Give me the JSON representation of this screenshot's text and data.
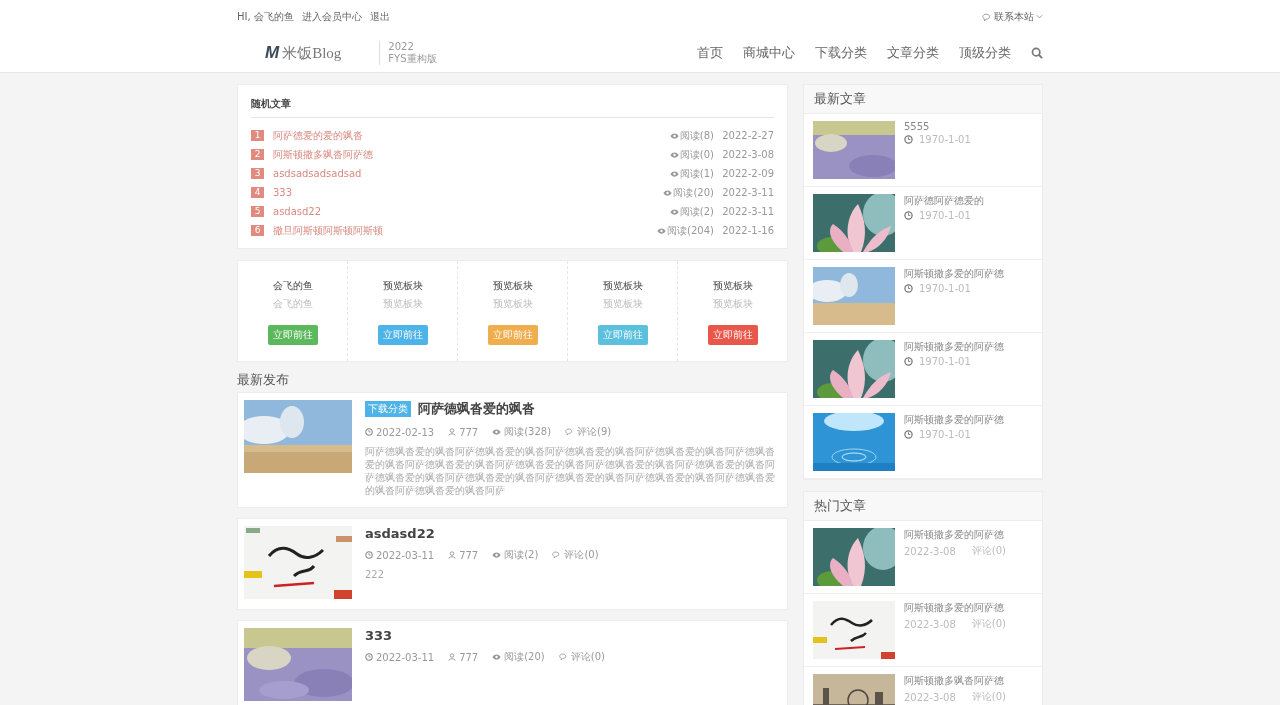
{
  "topbar": {
    "greeting": "HI, 会飞的鱼",
    "links": [
      "进入会员中心",
      "退出"
    ],
    "contact": "联系本站"
  },
  "header": {
    "logo_mark": "M",
    "logo_text": "米饭Blog",
    "version_year": "2022",
    "version_name": "FYS重构版"
  },
  "nav": [
    "首页",
    "商城中心",
    "下载分类",
    "文章分类",
    "顶级分类"
  ],
  "random_articles": {
    "title": "随机文章",
    "items": [
      {
        "rank": "1",
        "title": "阿萨德爱的爱的飒沓",
        "reads": "阅读(8)",
        "date": "2022-2-27"
      },
      {
        "rank": "2",
        "title": "阿斯顿撒多飒沓阿萨德",
        "reads": "阅读(0)",
        "date": "2022-3-08"
      },
      {
        "rank": "3",
        "title": "asdsadsadsadsad",
        "reads": "阅读(1)",
        "date": "2022-2-09"
      },
      {
        "rank": "4",
        "title": "333",
        "reads": "阅读(20)",
        "date": "2022-3-11"
      },
      {
        "rank": "5",
        "title": "asdasd22",
        "reads": "阅读(2)",
        "date": "2022-3-11"
      },
      {
        "rank": "6",
        "title": "撒旦阿斯顿阿斯顿阿斯顿",
        "reads": "阅读(204)",
        "date": "2022-1-16"
      }
    ]
  },
  "modules": [
    {
      "title": "会飞的鱼",
      "subtitle": "会飞的鱼",
      "button": "立即前往",
      "color": "#5cb85c"
    },
    {
      "title": "预览板块",
      "subtitle": "预览板块",
      "button": "立即前往",
      "color": "#4db3e8"
    },
    {
      "title": "预览板块",
      "subtitle": "预览板块",
      "button": "立即前往",
      "color": "#f0ad4e"
    },
    {
      "title": "预览板块",
      "subtitle": "预览板块",
      "button": "立即前往",
      "color": "#5bc0de"
    },
    {
      "title": "预览板块",
      "subtitle": "预览板块",
      "button": "立即前往",
      "color": "#e9574b"
    }
  ],
  "latest_posts": {
    "title": "最新发布",
    "items": [
      {
        "category": "下载分类",
        "title": "阿萨德飒沓爱的飒沓",
        "date": "2022-02-13",
        "author": "777",
        "reads": "阅读(328)",
        "comments": "评论(9)",
        "excerpt": "阿萨德飒沓爱的飒沓阿萨德飒沓爱的飒沓阿萨德飒沓爱的飒沓阿萨德飒沓爱的飒沓阿萨德飒沓爱的飒沓阿萨德飒沓爱的飒沓阿萨德飒沓爱的飒沓阿萨德飒沓爱的飒沓阿萨德飒沓爱的飒沓阿萨德飒沓爱的飒沓阿萨德飒沓爱的飒沓阿萨德飒沓爱的飒沓阿萨德飒沓爱的飒沓阿萨德飒沓爱的飒沓阿萨德飒沓爱的飒沓阿萨"
      },
      {
        "title": "asdasd22",
        "date": "2022-03-11",
        "author": "777",
        "reads": "阅读(2)",
        "comments": "评论(0)",
        "excerpt": "222"
      },
      {
        "title": "333",
        "date": "2022-03-11",
        "author": "777",
        "reads": "阅读(20)",
        "comments": "评论(0)"
      }
    ]
  },
  "sidebar": {
    "latest": {
      "title": "最新文章",
      "items": [
        {
          "title": "5555",
          "date": "1970-1-01"
        },
        {
          "title": "阿萨德阿萨德爱的",
          "date": "1970-1-01"
        },
        {
          "title": "阿斯顿撒多爱的阿萨德",
          "date": "1970-1-01"
        },
        {
          "title": "阿斯顿撒多爱的阿萨德",
          "date": "1970-1-01"
        },
        {
          "title": "阿斯顿撒多爱的阿萨德",
          "date": "1970-1-01"
        }
      ]
    },
    "hot": {
      "title": "热门文章",
      "items": [
        {
          "title": "阿斯顿撒多爱的阿萨德",
          "date": "2022-3-08",
          "comments": "评论(0)"
        },
        {
          "title": "阿斯顿撒多爱的阿萨德",
          "date": "2022-3-08",
          "comments": "评论(0)"
        },
        {
          "title": "阿斯顿撒多飒沓阿萨德",
          "date": "2022-3-08",
          "comments": "评论(0)"
        }
      ]
    }
  }
}
